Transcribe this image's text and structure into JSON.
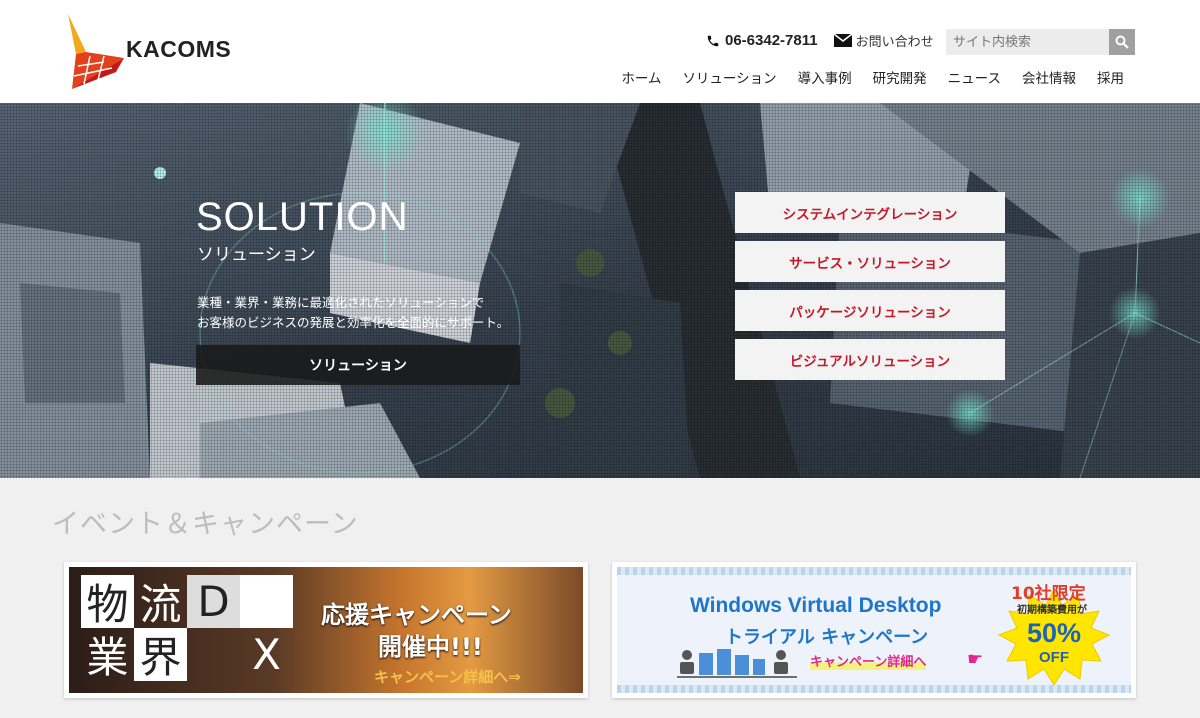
{
  "header": {
    "logo_text": "KACOMS",
    "phone": "06-6342-7811",
    "contact_label": "お問い合わせ",
    "search_placeholder": "サイト内検索",
    "nav": [
      "ホーム",
      "ソリューション",
      "導入事例",
      "研究開発",
      "ニュース",
      "会社情報",
      "採用"
    ]
  },
  "hero": {
    "title": "SOLUTION",
    "subtitle": "ソリューション",
    "desc_line1": "業種・業界・業務に最適化されたソリューションで",
    "desc_line2": "お客様のビジネスの発展と効率化を全面的にサポート。",
    "button_label": "ソリューション",
    "solutions": [
      "システムインテグレーション",
      "サービス・ソリューション",
      "パッケージソリューション",
      "ビジュアルソリューション"
    ]
  },
  "events": {
    "title": "イベント＆キャンペーン",
    "banner1": {
      "cells": [
        "物",
        "流",
        "D",
        "業",
        "界",
        "X"
      ],
      "line1": "応援キャンペーン",
      "line2": "開催中!!!",
      "line3": "キャンペーン詳細へ⇒"
    },
    "banner2": {
      "title": "Windows Virtual Desktop",
      "subtitle": "トライアル キャンペーン",
      "link": "キャンペーン詳細へ",
      "limit": "10社限定",
      "cost": "初期構築費用が",
      "percent": "50%",
      "off": "OFF"
    }
  },
  "colors": {
    "accent_red": "#c3182b",
    "windows_blue": "#1f76c9",
    "logo_red": "#d6221b",
    "logo_yellow": "#f3a81b"
  }
}
